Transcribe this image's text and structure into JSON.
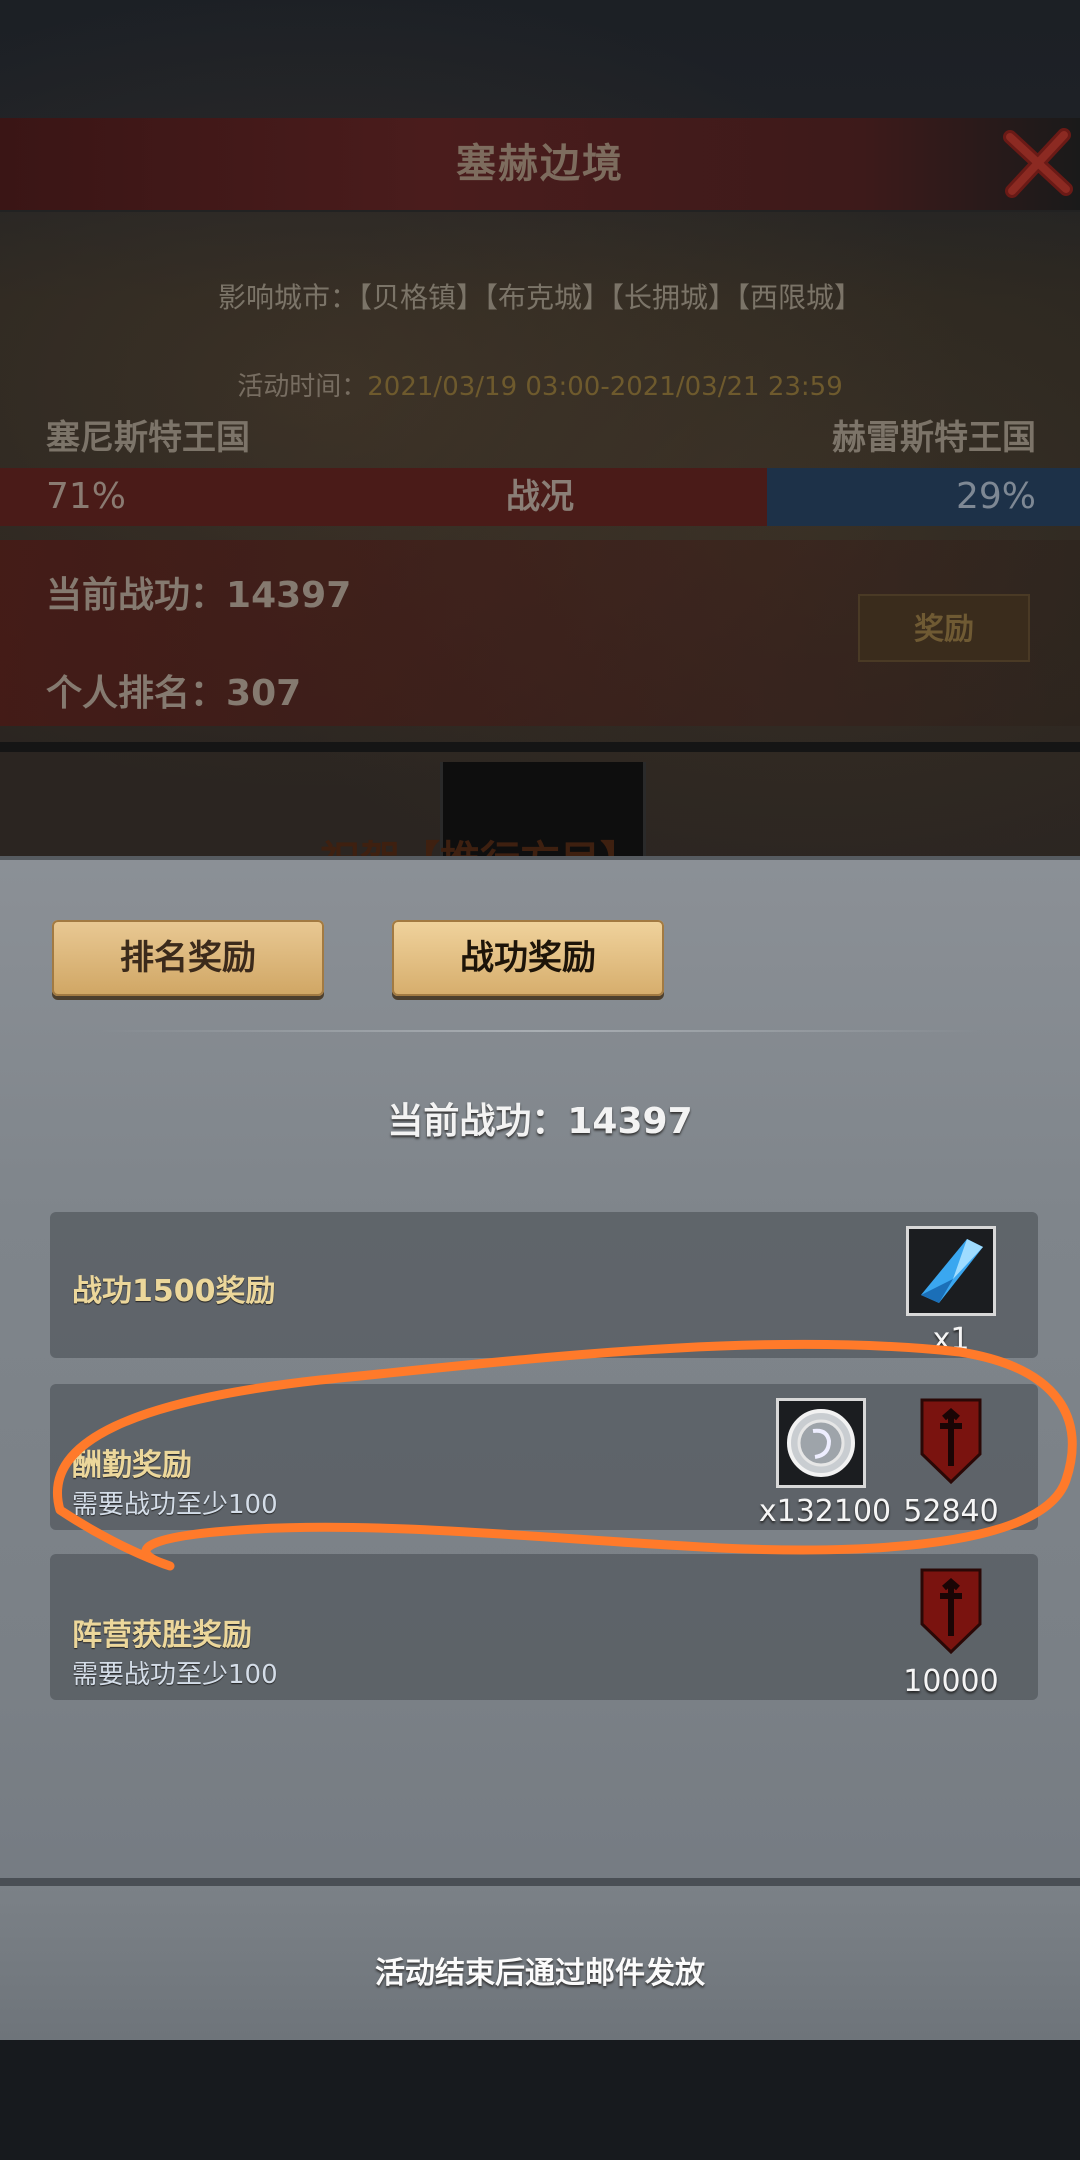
{
  "header": {
    "title": "塞赫边境"
  },
  "event": {
    "cities_label": "影响城市：",
    "cities": "【贝格镇】【布克城】【长拥城】【西限城】",
    "time_label": "活动时间：",
    "time_value": "2021/03/19 03:00-2021/03/21 23:59"
  },
  "war": {
    "left_kingdom": "塞尼斯特王国",
    "right_kingdom": "赫雷斯特王国",
    "left_percent": "71%",
    "right_percent": "29%",
    "left_share": 0.71,
    "center_label": "战况",
    "merit_label": "当前战功：",
    "merit_value": "14397",
    "rank_label": "个人排名：",
    "rank_value": "307",
    "reward_button": "奖励",
    "hidden_heading": "祝贺【推行方目】"
  },
  "modal": {
    "tabs": [
      {
        "label": "排名奖励"
      },
      {
        "label": "战功奖励"
      }
    ],
    "current_merit": "当前战功：14397",
    "rows": [
      {
        "title": "战功1500奖励",
        "subtitle": "",
        "items": [
          {
            "icon": "blue-crystal-icon",
            "qty": "x1"
          }
        ]
      },
      {
        "title": "酬勤奖励",
        "subtitle": "需要战功至少100",
        "items": [
          {
            "icon": "silver-coin-icon",
            "qty": "x132100"
          },
          {
            "icon": "red-shield-icon",
            "qty": "52840"
          }
        ]
      },
      {
        "title": "阵营获胜奖励",
        "subtitle": "需要战功至少100",
        "items": [
          {
            "icon": "red-shield-icon",
            "qty": "10000"
          }
        ]
      }
    ],
    "footer_note": "活动结束后通过邮件发放"
  },
  "colors": {
    "annotation": "#ff7a2a",
    "tab_gold": "#d9b173",
    "title_gold": "#ecd79b"
  }
}
